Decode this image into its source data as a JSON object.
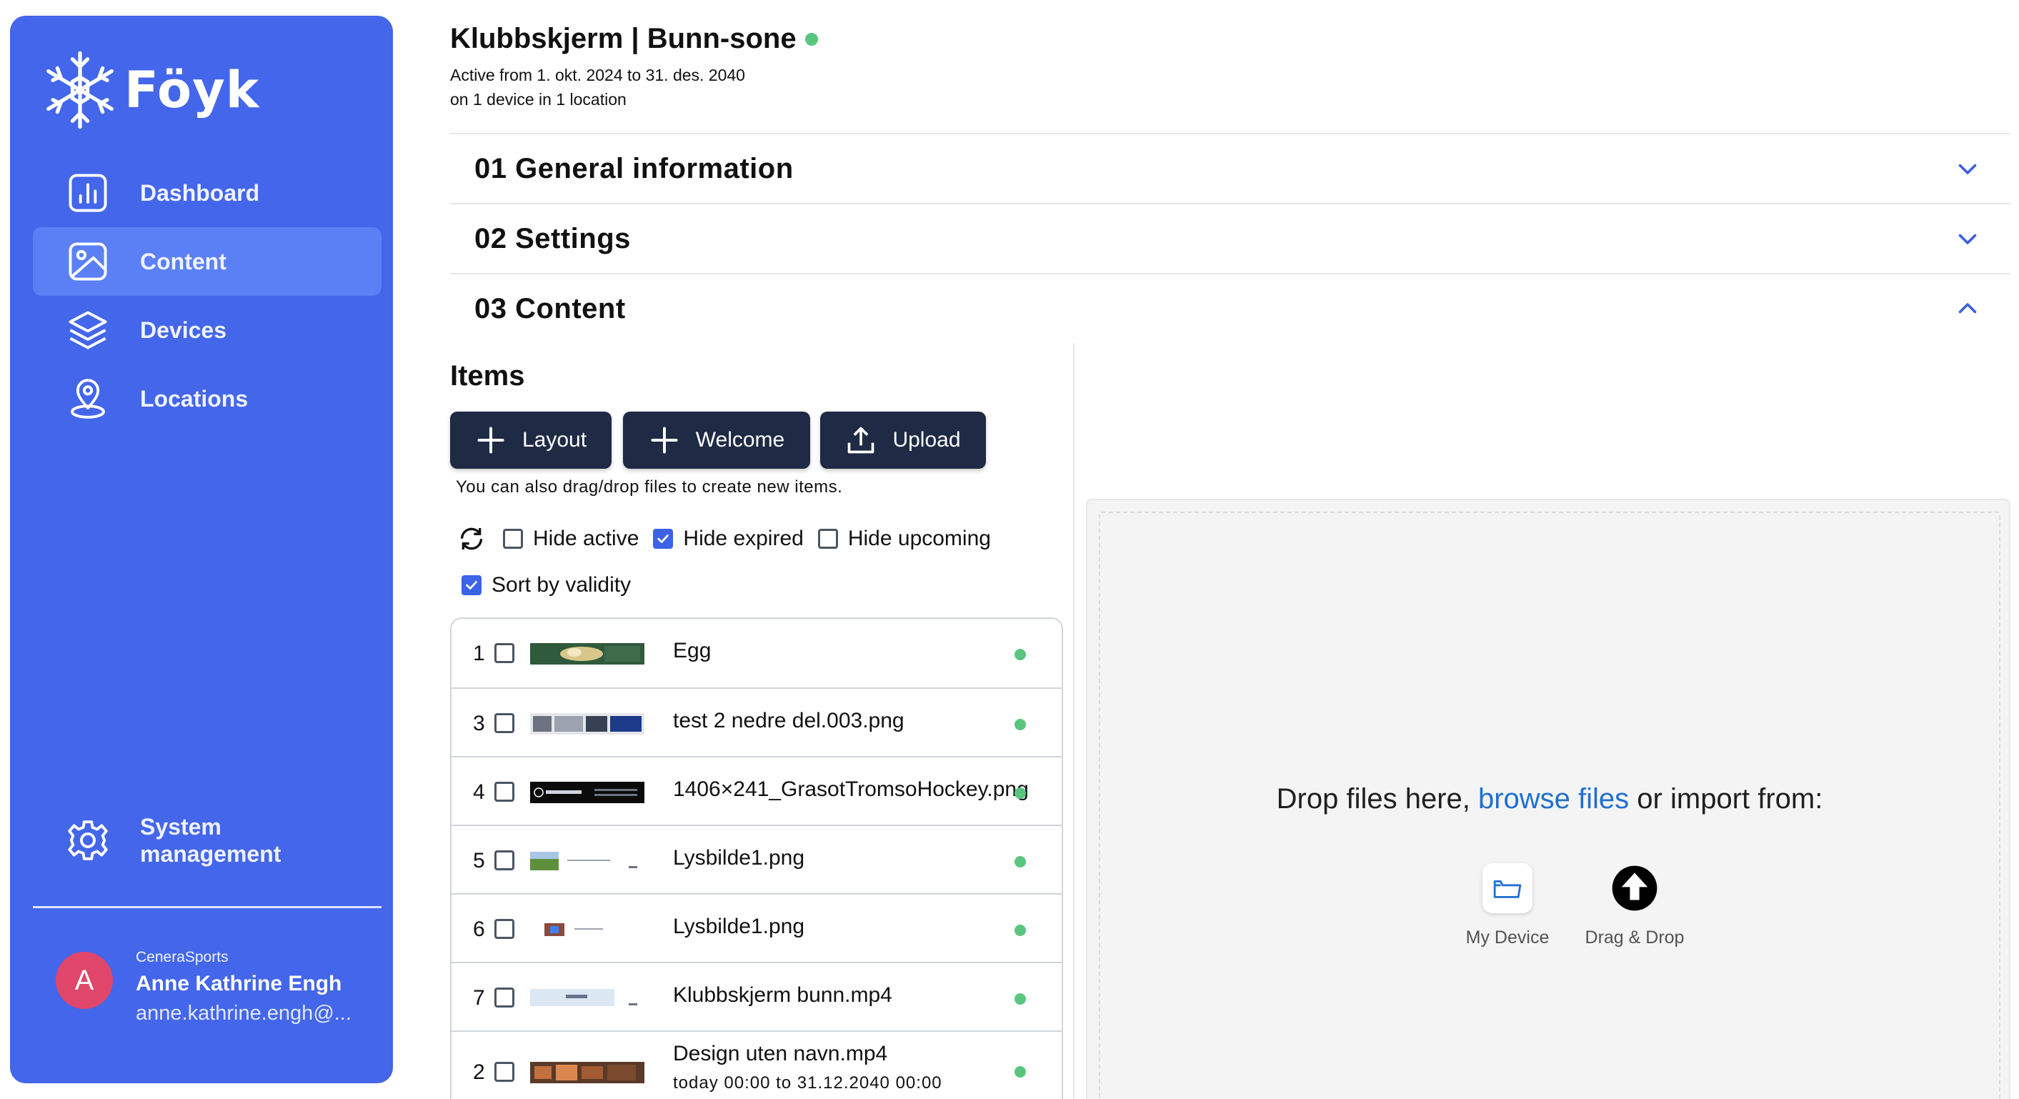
{
  "brand": {
    "name": "Föyk"
  },
  "sidebar": {
    "items": [
      {
        "label": "Dashboard",
        "icon": "chart-icon"
      },
      {
        "label": "Content",
        "icon": "image-icon",
        "active": true
      },
      {
        "label": "Devices",
        "icon": "layers-icon"
      },
      {
        "label": "Locations",
        "icon": "location-pin-icon"
      }
    ],
    "system_line1": "System",
    "system_line2": "management",
    "user": {
      "org": "CeneraSports",
      "name": "Anne Kathrine Engh",
      "email": "anne.kathrine.engh@...",
      "initial": "A"
    }
  },
  "header": {
    "title": "Klubbskjerm | Bunn-sone",
    "active_range": "Active from 1. okt. 2024 to 31. des. 2040",
    "devices": "on 1 device in 1 location"
  },
  "sections": [
    {
      "label": "01 General information",
      "expanded": false
    },
    {
      "label": "02 Settings",
      "expanded": false
    },
    {
      "label": "03 Content",
      "expanded": true
    }
  ],
  "items": {
    "title": "Items",
    "buttons": {
      "layout": "Layout",
      "welcome": "Welcome",
      "upload": "Upload"
    },
    "hint": "You can also drag/drop files to create new items.",
    "filters": {
      "hide_active": {
        "label": "Hide active",
        "checked": false
      },
      "hide_expired": {
        "label": "Hide expired",
        "checked": true
      },
      "hide_upcoming": {
        "label": "Hide upcoming",
        "checked": false
      },
      "sort_validity": {
        "label": "Sort by validity",
        "checked": true
      }
    },
    "rows": [
      {
        "num": "1",
        "name": "Egg",
        "range": ""
      },
      {
        "num": "3",
        "name": "test 2 nedre del.003.png",
        "range": ""
      },
      {
        "num": "4",
        "name": "1406×241_GrasotTromsoHockey.png",
        "range": ""
      },
      {
        "num": "5",
        "name": "Lysbilde1.png",
        "range": ""
      },
      {
        "num": "6",
        "name": "Lysbilde1.png",
        "range": ""
      },
      {
        "num": "7",
        "name": "Klubbskjerm bunn.mp4",
        "range": ""
      },
      {
        "num": "2",
        "name": "Design uten navn.mp4",
        "range": "today 00:00 to 31.12.2040 00:00"
      }
    ]
  },
  "dropzone": {
    "prefix": "Drop files here, ",
    "link": "browse files",
    "suffix": " or import from:",
    "sources": {
      "device": "My Device",
      "dragdrop": "Drag & Drop"
    }
  },
  "colors": {
    "sidebar": "#4466ea",
    "sidebar_active": "#5b80f6",
    "button": "#1f2a44",
    "status_dot": "#59c57f",
    "link": "#1f6fd1"
  }
}
